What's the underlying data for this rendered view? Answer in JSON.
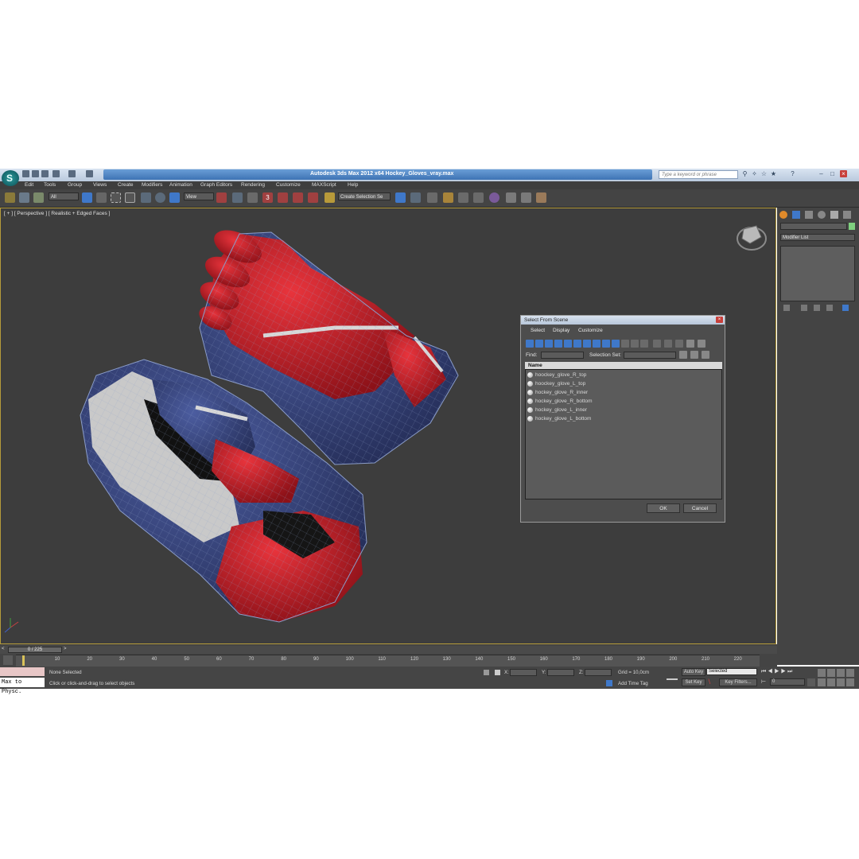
{
  "window": {
    "title": "Autodesk 3ds Max  2012 x64      Hockey_Gloves_vray.max",
    "logo_icon": "3dsmax-logo-icon",
    "search_placeholder": "Type a keyword or phrase"
  },
  "menu": [
    "Edit",
    "Tools",
    "Group",
    "Views",
    "Create",
    "Modifiers",
    "Animation",
    "Graph Editors",
    "Rendering",
    "Customize",
    "MAXScript",
    "Help"
  ],
  "toolbar": {
    "filter_value": "All",
    "refcoord_value": "View",
    "named_selection_value": "Create Selection Se",
    "snap_label": "3"
  },
  "viewport": {
    "label": "[ + ] [ Perspective ] [ Realistic + Edged Faces ]"
  },
  "command_panel": {
    "modifier_list_label": "Modifier List"
  },
  "dialog": {
    "title": "Select From Scene",
    "menu": [
      "Select",
      "Display",
      "Customize"
    ],
    "find_label": "Find:",
    "selection_set_label": "Selection Set:",
    "column_name": "Name",
    "items": [
      "hoockey_glove_R_top",
      "hoockey_glove_L_top",
      "hockey_glove_R_inner",
      "hockey_glove_R_bottom",
      "hockey_glove_L_inner",
      "hockey_glove_L_bottom"
    ],
    "ok_label": "OK",
    "cancel_label": "Cancel"
  },
  "timeline": {
    "frame_counter": "0 / 225",
    "current_frame": 0,
    "total_frames": 225,
    "ticks": [
      "10",
      "20",
      "30",
      "40",
      "50",
      "60",
      "70",
      "80",
      "90",
      "100",
      "110",
      "120",
      "130",
      "140",
      "150",
      "160",
      "170",
      "180",
      "190",
      "200",
      "210",
      "220"
    ]
  },
  "status": {
    "maxscript_label": "Max to Physc.",
    "selection_status": "None Selected",
    "prompt": "Click or click-and-drag to select objects",
    "x_label": "X:",
    "y_label": "Y:",
    "z_label": "Z:",
    "grid": "Grid = 10,0cm",
    "add_time_tag": "Add Time Tag",
    "auto_key": "Auto Key",
    "auto_key_value": "Selected",
    "set_key": "Set Key",
    "key_filters": "Key Filters...",
    "frame_field": "0"
  },
  "colors": {
    "glove_red": "#c8202a",
    "glove_blue": "#3c4a86",
    "glove_white": "#cfcfcf",
    "viewport_bg": "#3d3d3d",
    "active_border": "#b59b3a"
  }
}
